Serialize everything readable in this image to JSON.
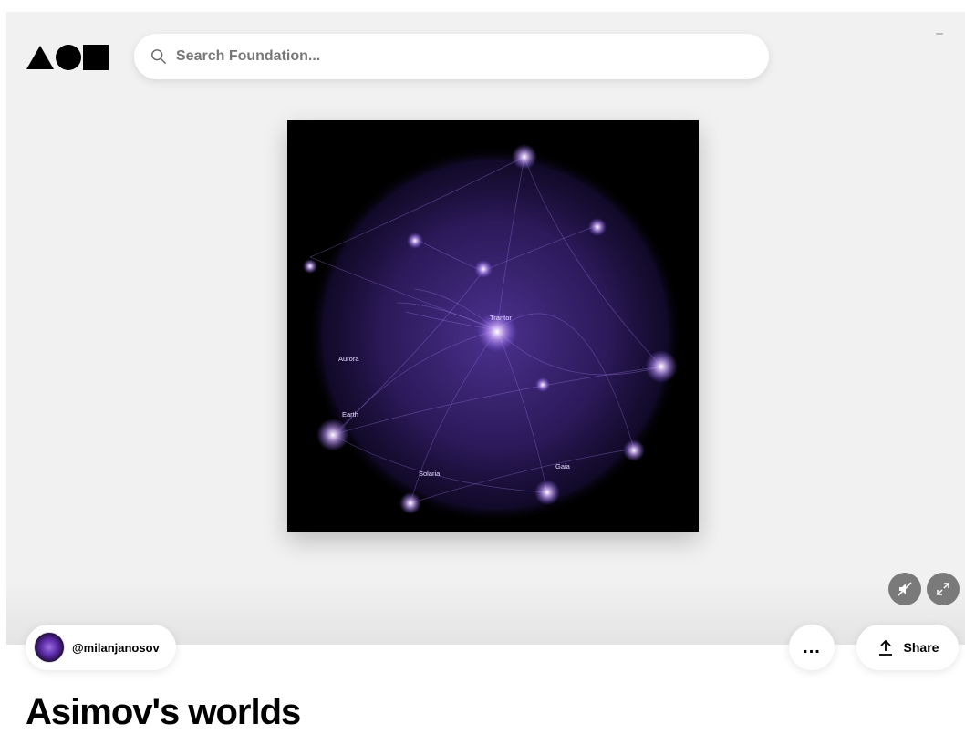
{
  "search": {
    "placeholder": "Search Foundation..."
  },
  "artwork": {
    "labels": [
      "Trantor",
      "Aurora",
      "Earth",
      "Solaria",
      "Gaia"
    ],
    "accent": "#8a5cff",
    "background": "#000000"
  },
  "creator": {
    "handle": "@milanjanosov"
  },
  "actions": {
    "more_label": "...",
    "share_label": "Share"
  },
  "page": {
    "title": "Asimov's worlds"
  },
  "icons": {
    "logo": "shapes-logo",
    "search": "search-icon",
    "mute": "mute-icon",
    "expand": "expand-icon",
    "share": "share-icon"
  }
}
